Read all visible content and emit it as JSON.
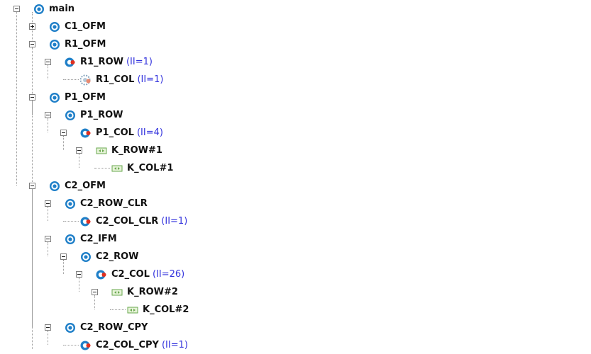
{
  "tree": [
    {
      "label": "main",
      "depth": 0,
      "type": "function",
      "toggle": "expanded"
    },
    {
      "label": "C1_OFM",
      "depth": 1,
      "type": "function",
      "toggle": "collapsed"
    },
    {
      "label": "R1_OFM",
      "depth": 1,
      "type": "function",
      "toggle": "expanded"
    },
    {
      "label": "R1_ROW",
      "ii": "(II=1)",
      "depth": 2,
      "type": "loop-pipelined",
      "toggle": "expanded"
    },
    {
      "label": "R1_COL",
      "ii": "(II=1)",
      "depth": 3,
      "type": "loop-flattened",
      "toggle": "none"
    },
    {
      "label": "P1_OFM",
      "depth": 1,
      "type": "function",
      "toggle": "expanded"
    },
    {
      "label": "P1_ROW",
      "depth": 2,
      "type": "function",
      "toggle": "expanded"
    },
    {
      "label": "P1_COL",
      "ii": "(II=4)",
      "depth": 3,
      "type": "loop-pipelined",
      "toggle": "expanded"
    },
    {
      "label": "K_ROW#1",
      "depth": 4,
      "type": "loop-unrolled",
      "toggle": "expanded"
    },
    {
      "label": "K_COL#1",
      "depth": 5,
      "type": "loop-unrolled",
      "toggle": "none"
    },
    {
      "label": "C2_OFM",
      "depth": 1,
      "type": "function",
      "toggle": "expanded"
    },
    {
      "label": "C2_ROW_CLR",
      "depth": 2,
      "type": "function",
      "toggle": "expanded"
    },
    {
      "label": "C2_COL_CLR",
      "ii": "(II=1)",
      "depth": 3,
      "type": "loop-pipelined",
      "toggle": "none"
    },
    {
      "label": "C2_IFM",
      "depth": 2,
      "type": "function",
      "toggle": "expanded"
    },
    {
      "label": "C2_ROW",
      "depth": 3,
      "type": "function",
      "toggle": "expanded"
    },
    {
      "label": "C2_COL",
      "ii": "(II=26)",
      "depth": 4,
      "type": "loop-pipelined",
      "toggle": "expanded"
    },
    {
      "label": "K_ROW#2",
      "depth": 5,
      "type": "loop-unrolled",
      "toggle": "expanded"
    },
    {
      "label": "K_COL#2",
      "depth": 6,
      "type": "loop-unrolled",
      "toggle": "none"
    },
    {
      "label": "C2_ROW_CPY",
      "depth": 2,
      "type": "function",
      "toggle": "expanded"
    },
    {
      "label": "C2_COL_CPY",
      "ii": "(II=1)",
      "depth": 3,
      "type": "loop-pipelined",
      "toggle": "none"
    }
  ],
  "colors": {
    "ii_text": "#3333dd",
    "function_icon": "#1f7fc8",
    "pipeline_arrow": "#e03020",
    "unroll_icon": "#6aa84f"
  }
}
